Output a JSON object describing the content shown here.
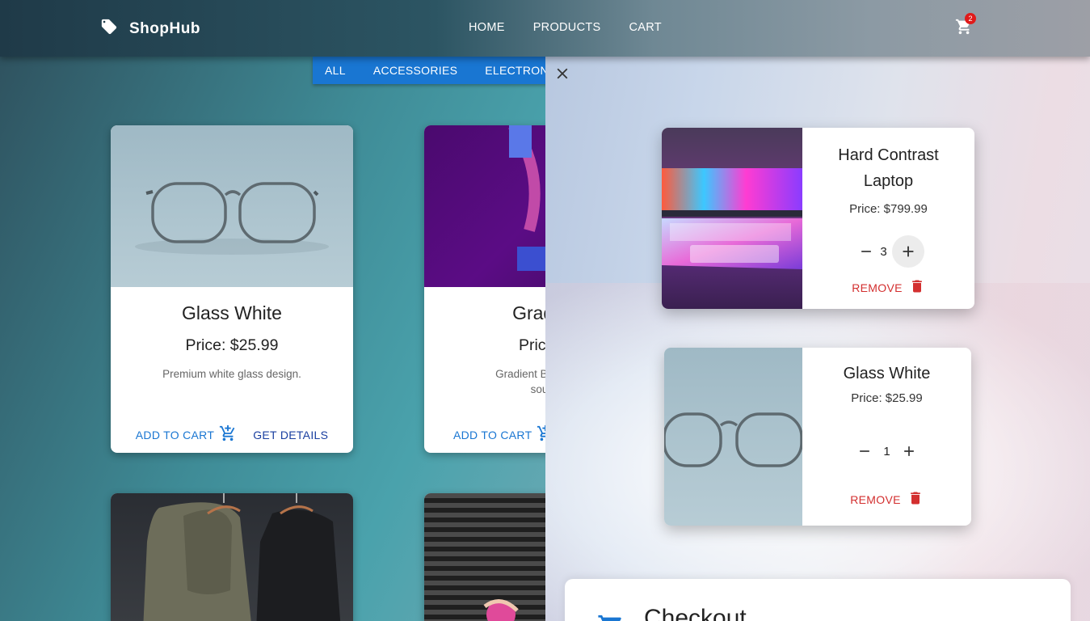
{
  "app": {
    "name": "ShopHub"
  },
  "nav": {
    "items": [
      "HOME",
      "PRODUCTS",
      "CART"
    ]
  },
  "cart_badge": "2",
  "categories": [
    "ALL",
    "ACCESSORIES",
    "ELECTRON"
  ],
  "products": [
    {
      "title": "Glass White",
      "price": "Price: $25.99",
      "description": "Premium white glass design.",
      "add_label": "ADD TO CART",
      "details_label": "GET DETAILS"
    },
    {
      "title": "Gradien",
      "price": "Price: $",
      "description_line1": "Gradient Beats head",
      "description_line2": "sound",
      "add_label": "ADD TO CART"
    }
  ],
  "cart": {
    "items": [
      {
        "title_line1": "Hard Contrast",
        "title_line2": "Laptop",
        "price": "Price: $799.99",
        "qty": "3",
        "remove_label": "REMOVE"
      },
      {
        "title": "Glass White",
        "price": "Price: $25.99",
        "qty": "1",
        "remove_label": "REMOVE"
      }
    ],
    "checkout_label": "Checkout"
  },
  "colors": {
    "primary": "#1976d2",
    "danger": "#d32f2f",
    "badge": "#e01a1a"
  }
}
